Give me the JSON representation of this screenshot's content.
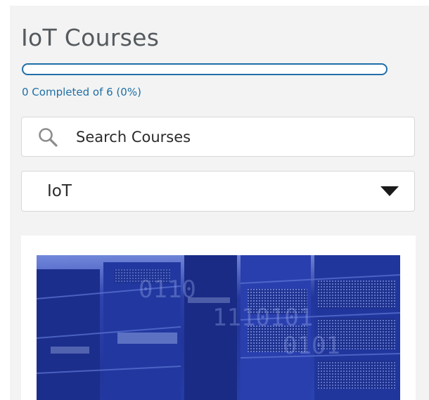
{
  "page": {
    "title": "IoT Courses"
  },
  "progress": {
    "completed": 0,
    "total": 6,
    "percent": 0,
    "label": "0 Completed of 6 (0%)"
  },
  "search": {
    "placeholder": "Search Courses",
    "icon": "search-icon"
  },
  "filter": {
    "selected": "IoT",
    "icon": "chevron-down-icon"
  },
  "courses": [
    {
      "image_subject": "data-center-server-racks"
    }
  ],
  "colors": {
    "accent": "#1f6fa8",
    "title_text": "#555a5e",
    "panel_bg": "#f3f3f3",
    "image_blue": "#1f3a9e"
  }
}
